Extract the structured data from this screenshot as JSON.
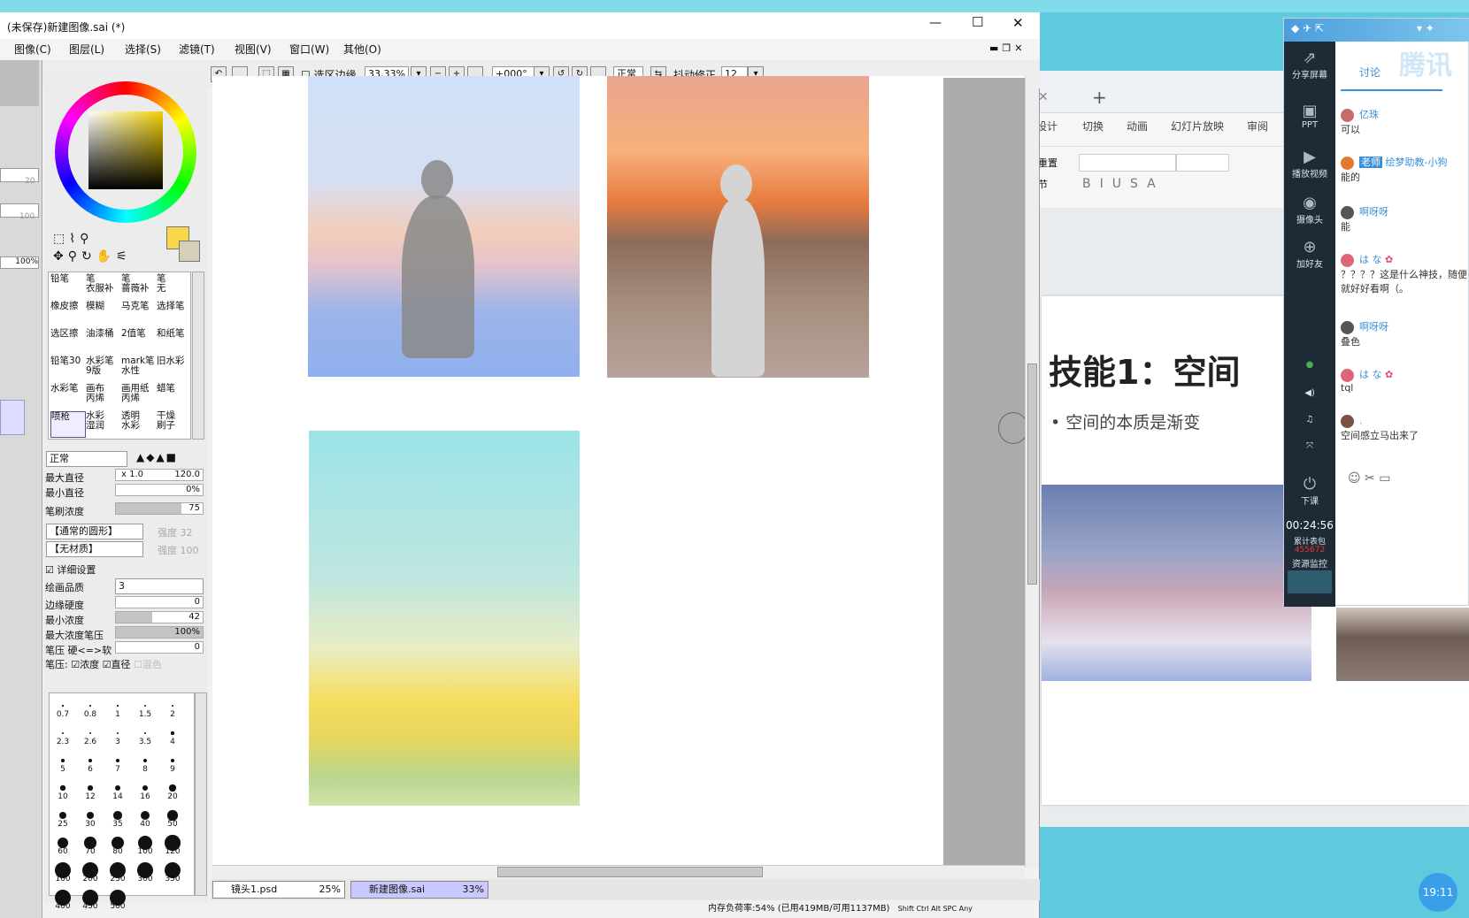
{
  "sai": {
    "title": "(未保存)新建图像.sai (*)",
    "menu": [
      "图像(C)",
      "图层(L)",
      "选择(S)",
      "滤镜(T)",
      "视图(V)",
      "窗口(W)",
      "其他(O)"
    ],
    "toolbar": {
      "selection_edge": "选区边缘",
      "zoom": "33.33%",
      "rotation": "+000°",
      "blend": "正常",
      "stabilizer_label": "抖动修正",
      "stabilizer_value": "12"
    },
    "strip_values": [
      "20",
      "100",
      "100%"
    ],
    "tools": [
      [
        "铅笔",
        "笔\n衣服补",
        "笔\n蔷薇补",
        "笔\n无"
      ],
      [
        "橡皮擦",
        "模糊",
        "马克笔",
        "选择笔"
      ],
      [
        "选区擦",
        "油漆桶",
        "2值笔",
        "和纸笔"
      ],
      [
        "铅笔30",
        "水彩笔\n9版",
        "mark笔\n水性",
        "旧水彩"
      ],
      [
        "水彩笔",
        "画布\n丙烯",
        "画用纸\n丙烯",
        "蜡笔"
      ],
      [
        "喷枪",
        "水彩\n湿润",
        "透明\n水彩",
        "干燥\n刷子"
      ]
    ],
    "brush": {
      "mode": "正常",
      "max_diameter_label": "最大直径",
      "max_diameter_mult": "x 1.0",
      "max_diameter_value": "120.0",
      "min_diameter_label": "最小直径",
      "min_diameter_value": "0%",
      "density_label": "笔刷浓度",
      "density_value": "75",
      "density_level": 0.75,
      "shape": "【通常的圆形】",
      "shape_strength_label": "强度",
      "shape_strength": "32",
      "texture": "【无材质】",
      "texture_strength_label": "强度",
      "texture_strength": "100",
      "detail_label": "详细设置",
      "quality_label": "绘画品质",
      "quality_value": "3",
      "edge_label": "边缘硬度",
      "edge_value": "0",
      "min_density_label": "最小浓度",
      "min_density_value": "42",
      "min_density_level": 0.42,
      "max_pressure_label": "最大浓度笔压",
      "max_pressure_value": "100%",
      "max_pressure_level": 1.0,
      "pressure_label": "笔压 硬<=>软",
      "pressure_value": "0",
      "pressure_opts": "笔压:",
      "opt_density": "浓度",
      "opt_diameter": "直径",
      "opt_mix": "混色"
    },
    "brush_sizes": [
      "0.7",
      "0.8",
      "1",
      "1.5",
      "2",
      "2.3",
      "2.6",
      "3",
      "3.5",
      "4",
      "5",
      "6",
      "7",
      "8",
      "9",
      "10",
      "12",
      "14",
      "16",
      "20",
      "25",
      "30",
      "35",
      "40",
      "50",
      "60",
      "70",
      "80",
      "100",
      "120",
      "160",
      "200",
      "250",
      "300",
      "350",
      "400",
      "450",
      "500"
    ],
    "files": [
      {
        "name": "镜头1.psd",
        "zoom": "25%"
      },
      {
        "name": "新建图像.sai",
        "zoom": "33%"
      }
    ],
    "status": "内存负荷率:54% (已用419MB/可用1137MB)",
    "keys": [
      "Shift",
      "Ctrl",
      "Alt",
      "SPC",
      "Any"
    ]
  },
  "ppt": {
    "tabs": [
      "设计",
      "切换",
      "动画",
      "幻灯片放映",
      "审阅"
    ],
    "reset_label": "重置",
    "section_label": "节",
    "slide_title": "技能1：空间",
    "slide_bullet": "空间的本质是渐变"
  },
  "tencent": {
    "brand": "腾讯",
    "tab": "讨论",
    "side": [
      "分享屏幕",
      "PPT",
      "播放视频",
      "摄像头",
      "加好友",
      "下课"
    ],
    "timer": "00:24:56",
    "gift_label": "累计表包",
    "gift_value": "455672",
    "monitor": "资源监控",
    "messages": [
      {
        "name": "亿珠",
        "text": "可以"
      },
      {
        "badge": "老师",
        "name": "绘梦助教-小狗",
        "text": "能的"
      },
      {
        "name": "啊呀呀",
        "text": "能"
      },
      {
        "name": "は な",
        "text": "？？？？这是什么神技，随便就好好看啊（。"
      },
      {
        "name": "啊呀呀",
        "text": "叠色"
      },
      {
        "name": "は な",
        "text": "tql"
      },
      {
        "name": ".",
        "text": "空间感立马出来了"
      }
    ]
  },
  "clock": "19:11"
}
